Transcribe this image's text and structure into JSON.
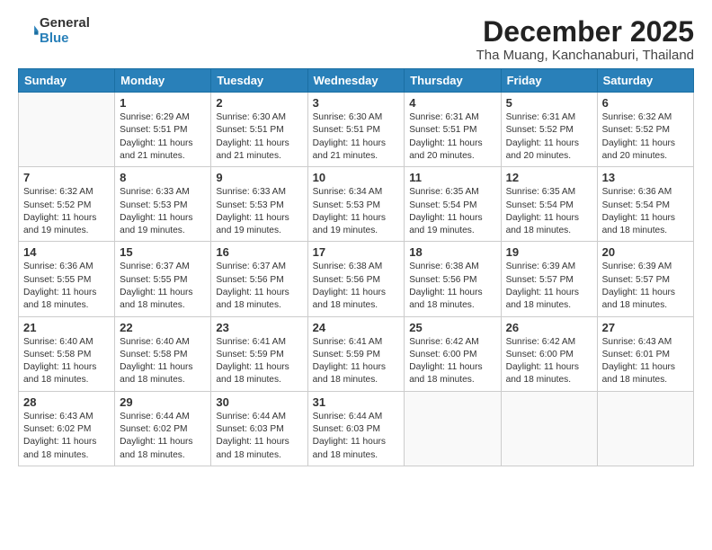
{
  "header": {
    "logo_general": "General",
    "logo_blue": "Blue",
    "month_title": "December 2025",
    "location": "Tha Muang, Kanchanaburi, Thailand"
  },
  "weekdays": [
    "Sunday",
    "Monday",
    "Tuesday",
    "Wednesday",
    "Thursday",
    "Friday",
    "Saturday"
  ],
  "weeks": [
    [
      {
        "day": "",
        "info": ""
      },
      {
        "day": "1",
        "info": "Sunrise: 6:29 AM\nSunset: 5:51 PM\nDaylight: 11 hours\nand 21 minutes."
      },
      {
        "day": "2",
        "info": "Sunrise: 6:30 AM\nSunset: 5:51 PM\nDaylight: 11 hours\nand 21 minutes."
      },
      {
        "day": "3",
        "info": "Sunrise: 6:30 AM\nSunset: 5:51 PM\nDaylight: 11 hours\nand 21 minutes."
      },
      {
        "day": "4",
        "info": "Sunrise: 6:31 AM\nSunset: 5:51 PM\nDaylight: 11 hours\nand 20 minutes."
      },
      {
        "day": "5",
        "info": "Sunrise: 6:31 AM\nSunset: 5:52 PM\nDaylight: 11 hours\nand 20 minutes."
      },
      {
        "day": "6",
        "info": "Sunrise: 6:32 AM\nSunset: 5:52 PM\nDaylight: 11 hours\nand 20 minutes."
      }
    ],
    [
      {
        "day": "7",
        "info": "Sunrise: 6:32 AM\nSunset: 5:52 PM\nDaylight: 11 hours\nand 19 minutes."
      },
      {
        "day": "8",
        "info": "Sunrise: 6:33 AM\nSunset: 5:53 PM\nDaylight: 11 hours\nand 19 minutes."
      },
      {
        "day": "9",
        "info": "Sunrise: 6:33 AM\nSunset: 5:53 PM\nDaylight: 11 hours\nand 19 minutes."
      },
      {
        "day": "10",
        "info": "Sunrise: 6:34 AM\nSunset: 5:53 PM\nDaylight: 11 hours\nand 19 minutes."
      },
      {
        "day": "11",
        "info": "Sunrise: 6:35 AM\nSunset: 5:54 PM\nDaylight: 11 hours\nand 19 minutes."
      },
      {
        "day": "12",
        "info": "Sunrise: 6:35 AM\nSunset: 5:54 PM\nDaylight: 11 hours\nand 18 minutes."
      },
      {
        "day": "13",
        "info": "Sunrise: 6:36 AM\nSunset: 5:54 PM\nDaylight: 11 hours\nand 18 minutes."
      }
    ],
    [
      {
        "day": "14",
        "info": "Sunrise: 6:36 AM\nSunset: 5:55 PM\nDaylight: 11 hours\nand 18 minutes."
      },
      {
        "day": "15",
        "info": "Sunrise: 6:37 AM\nSunset: 5:55 PM\nDaylight: 11 hours\nand 18 minutes."
      },
      {
        "day": "16",
        "info": "Sunrise: 6:37 AM\nSunset: 5:56 PM\nDaylight: 11 hours\nand 18 minutes."
      },
      {
        "day": "17",
        "info": "Sunrise: 6:38 AM\nSunset: 5:56 PM\nDaylight: 11 hours\nand 18 minutes."
      },
      {
        "day": "18",
        "info": "Sunrise: 6:38 AM\nSunset: 5:56 PM\nDaylight: 11 hours\nand 18 minutes."
      },
      {
        "day": "19",
        "info": "Sunrise: 6:39 AM\nSunset: 5:57 PM\nDaylight: 11 hours\nand 18 minutes."
      },
      {
        "day": "20",
        "info": "Sunrise: 6:39 AM\nSunset: 5:57 PM\nDaylight: 11 hours\nand 18 minutes."
      }
    ],
    [
      {
        "day": "21",
        "info": "Sunrise: 6:40 AM\nSunset: 5:58 PM\nDaylight: 11 hours\nand 18 minutes."
      },
      {
        "day": "22",
        "info": "Sunrise: 6:40 AM\nSunset: 5:58 PM\nDaylight: 11 hours\nand 18 minutes."
      },
      {
        "day": "23",
        "info": "Sunrise: 6:41 AM\nSunset: 5:59 PM\nDaylight: 11 hours\nand 18 minutes."
      },
      {
        "day": "24",
        "info": "Sunrise: 6:41 AM\nSunset: 5:59 PM\nDaylight: 11 hours\nand 18 minutes."
      },
      {
        "day": "25",
        "info": "Sunrise: 6:42 AM\nSunset: 6:00 PM\nDaylight: 11 hours\nand 18 minutes."
      },
      {
        "day": "26",
        "info": "Sunrise: 6:42 AM\nSunset: 6:00 PM\nDaylight: 11 hours\nand 18 minutes."
      },
      {
        "day": "27",
        "info": "Sunrise: 6:43 AM\nSunset: 6:01 PM\nDaylight: 11 hours\nand 18 minutes."
      }
    ],
    [
      {
        "day": "28",
        "info": "Sunrise: 6:43 AM\nSunset: 6:02 PM\nDaylight: 11 hours\nand 18 minutes."
      },
      {
        "day": "29",
        "info": "Sunrise: 6:44 AM\nSunset: 6:02 PM\nDaylight: 11 hours\nand 18 minutes."
      },
      {
        "day": "30",
        "info": "Sunrise: 6:44 AM\nSunset: 6:03 PM\nDaylight: 11 hours\nand 18 minutes."
      },
      {
        "day": "31",
        "info": "Sunrise: 6:44 AM\nSunset: 6:03 PM\nDaylight: 11 hours\nand 18 minutes."
      },
      {
        "day": "",
        "info": ""
      },
      {
        "day": "",
        "info": ""
      },
      {
        "day": "",
        "info": ""
      }
    ]
  ]
}
